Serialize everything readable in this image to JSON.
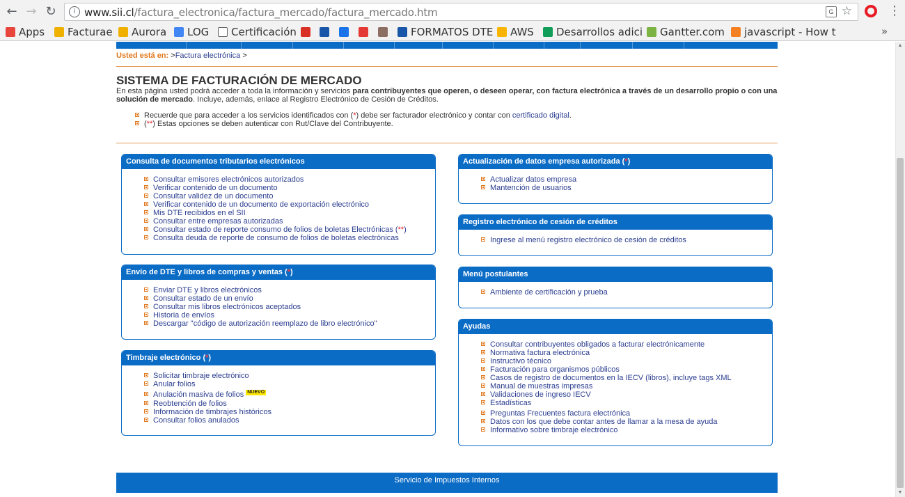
{
  "browser": {
    "url_host": "www.sii.cl",
    "url_path": "/factura_electronica/factura_mercado/factura_mercado.htm",
    "bookmarks": [
      {
        "label": "Apps",
        "icon": "apps-grid-icon",
        "color": "#e8453c"
      },
      {
        "label": "Facturae",
        "icon": "pma-icon",
        "color": "#f0b000"
      },
      {
        "label": "Aurora",
        "icon": "pma-icon",
        "color": "#f0b000"
      },
      {
        "label": "LOG",
        "icon": "google-g-icon",
        "color": "#4285f4"
      },
      {
        "label": "Certificación",
        "icon": "page-icon",
        "color": "#ffffff"
      },
      {
        "label": "",
        "icon": "gmail-icon",
        "color": "#d93025"
      },
      {
        "label": "",
        "icon": "sii-icon",
        "color": "#1a56a8"
      },
      {
        "label": "",
        "icon": "round-blue-icon",
        "color": "#1a73e8"
      },
      {
        "label": "",
        "icon": "pokeball-icon",
        "color": "#e53935"
      },
      {
        "label": "",
        "icon": "avatar-icon",
        "color": "#8d6e63"
      },
      {
        "label": "FORMATOS DTE",
        "icon": "sii-icon",
        "color": "#1a56a8"
      },
      {
        "label": "AWS",
        "icon": "aws-cube-icon",
        "color": "#f8b400"
      },
      {
        "label": "Desarrollos adici",
        "icon": "sheets-icon",
        "color": "#0f9d58"
      },
      {
        "label": "Gantter.com",
        "icon": "cloud-icon",
        "color": "#7cb342"
      },
      {
        "label": "javascript - How t",
        "icon": "stackoverflow-icon",
        "color": "#f48024"
      }
    ]
  },
  "breadcrumb": {
    "label": "Usted está en:",
    "prefix": ">",
    "link": "Factura electrónica",
    "suffix": ">"
  },
  "page_title": "SISTEMA DE FACTURACIÓN DE MERCADO",
  "intro": {
    "part1": "En esta página usted podrá acceder a toda la información y servicios ",
    "bold": "para contribuyentes que operen, o deseen operar, con factura electrónica a través de un desarrollo propio o con una solución de mercado",
    "part2": ". Incluye, además, enlace al Registro Electrónico de Cesión de Créditos."
  },
  "notes": {
    "n1_a": "Recuerde que para acceder a los servicios identificados con (",
    "n1_star": "*",
    "n1_b": ") debe ser facturador electrónico y contar con ",
    "n1_link": "certificado digital",
    "n1_c": ".",
    "n2_a": "(",
    "n2_star": "**",
    "n2_b": ") Estas opciones se deben autenticar con Rut/Clave del Contribuyente."
  },
  "boxes": {
    "consulta": {
      "title": "Consulta de documentos tributarios electrónicos",
      "items": [
        "Consultar emisores electrónicos autorizados",
        "Verificar contenido de un documento",
        "Consultar validez de un documento",
        "Verificar contenido de un documento de exportación electrónico",
        "Mis DTE recibidos en el SII",
        "Consultar entre empresas autorizadas",
        "Consultar estado de reporte consumo de folios de boletas Electrónicas (",
        "Consulta deuda de reporte de consumo de folios de boletas electrónicas"
      ],
      "item7_star": "**",
      "item7_close": ")"
    },
    "envio": {
      "title": "Envío de DTE y libros de compras y ventas (",
      "title_star": "*",
      "title_close": ")",
      "items": [
        "Enviar DTE y libros electrónicos",
        "Consultar estado de un envío",
        "Consultar mis libros electrónicos aceptados",
        "Historia de envíos",
        "Descargar \"código de autorización reemplazo de libro electrónico\""
      ]
    },
    "timbraje": {
      "title": "Timbraje electrónico (",
      "title_star": "*",
      "title_close": ")",
      "items": [
        "Solicitar timbraje electrónico",
        "Anular folios",
        "Anulación masiva de folios",
        "Reobtención de folios",
        "Información de timbrajes históricos",
        "Consultar folios anulados"
      ],
      "new_badge": "NUEVO"
    },
    "actualizacion": {
      "title": "Actualización de datos empresa autorizada (",
      "title_star": "*",
      "title_close": ")",
      "items": [
        "Actualizar datos empresa",
        "Mantención de usuarios"
      ]
    },
    "registro": {
      "title": "Registro electrónico de cesión de créditos",
      "items": [
        "Ingrese al menú registro electrónico de cesión de créditos"
      ]
    },
    "postulantes": {
      "title": "Menú postulantes",
      "items": [
        "Ambiente de certificación y prueba"
      ]
    },
    "ayudas": {
      "title": "Ayudas",
      "items": [
        "Consultar contribuyentes obligados a facturar electrónicamente",
        "Normativa factura electrónica",
        "Instructivo técnico",
        "Facturación para organismos públicos",
        "Casos de registro de documentos en la IECV (libros), incluye tags XML",
        "Manual de muestras impresas",
        "Validaciones de ingreso IECV",
        "Estadísticas",
        "Preguntas Frecuentes factura electrónica",
        "Datos con los que debe contar antes de llamar a la mesa de ayuda",
        "Informativo sobre timbraje electrónico"
      ]
    }
  },
  "footer": "Servicio de Impuestos Internos"
}
